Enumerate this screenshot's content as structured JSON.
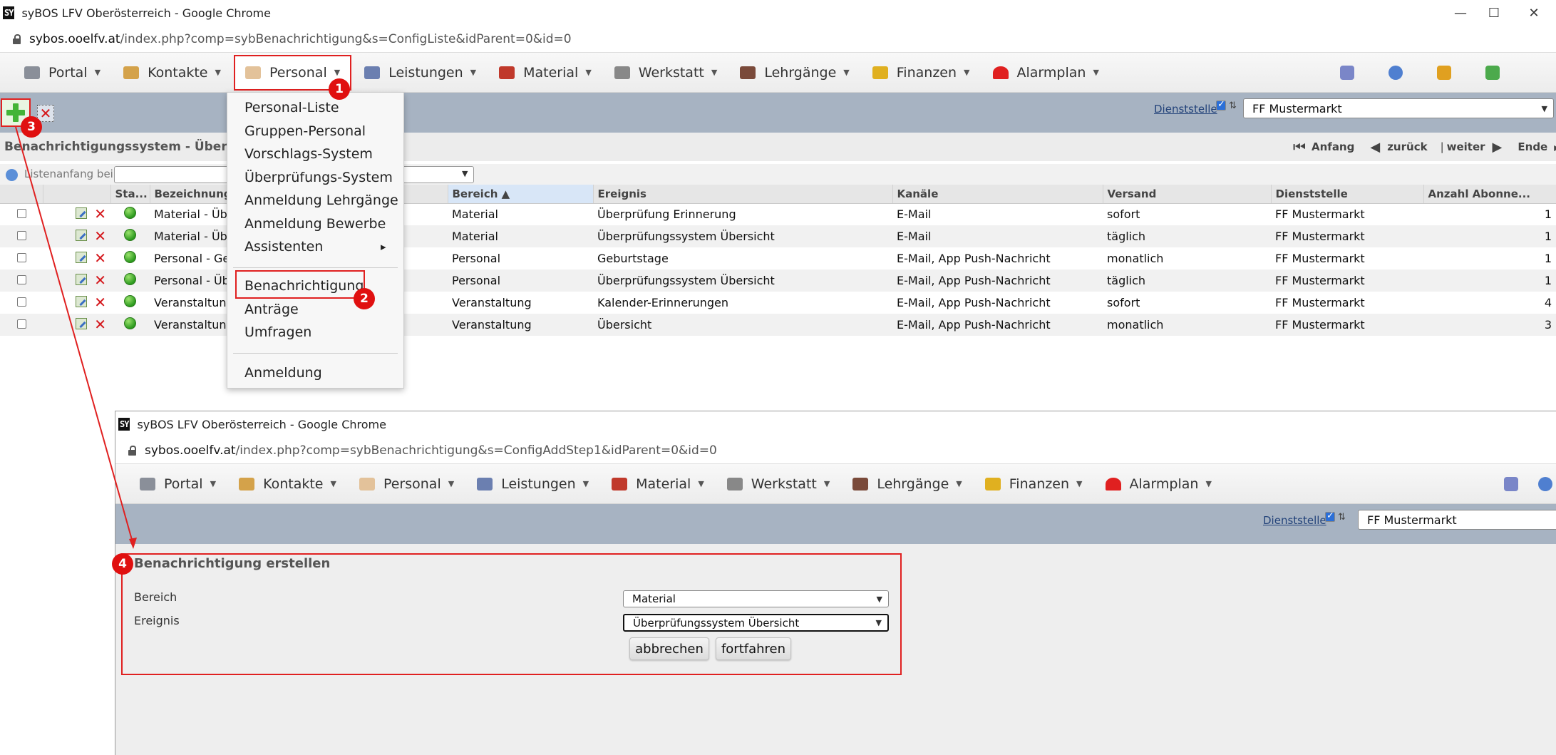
{
  "window": {
    "title": "syBOS LFV Oberösterreich - Google Chrome",
    "logo": "SY",
    "controls": [
      "—",
      "☐",
      "✕"
    ]
  },
  "address": {
    "host": "sybos.ooelfv.at",
    "path": "/index.php?comp=sybBenachrichtigung&s=ConfigListe&idParent=0&id=0"
  },
  "nav": {
    "items": [
      {
        "label": "Portal",
        "icon": "portal-icon",
        "color": "#8a8f99"
      },
      {
        "label": "Kontakte",
        "icon": "contacts-icon",
        "color": "#d4a24a"
      },
      {
        "label": "Personal",
        "icon": "person-icon",
        "color": "#e3c29a"
      },
      {
        "label": "Leistungen",
        "icon": "gears-icon",
        "color": "#6b7fb0"
      },
      {
        "label": "Material",
        "icon": "truck-icon",
        "color": "#c0392b"
      },
      {
        "label": "Werkstatt",
        "icon": "wrench-icon",
        "color": "#888888"
      },
      {
        "label": "Lehrgänge",
        "icon": "instructor-icon",
        "color": "#7a4a3a"
      },
      {
        "label": "Finanzen",
        "icon": "money-icon",
        "color": "#e0b020"
      },
      {
        "label": "Alarmplan",
        "icon": "siren-icon",
        "color": "#e02020"
      }
    ],
    "right_icons": [
      "network-icon",
      "info-icon",
      "phone-icon",
      "logout-icon"
    ]
  },
  "toolbar": {
    "dienststelle_label": "Dienststelle",
    "tree_icon": "⇅",
    "dienststelle_value": "FF Mustermarkt"
  },
  "page": {
    "title": "Benachrichtigungssystem - Übersi",
    "pager": {
      "first": "Anfang",
      "prev": "zurück",
      "sep": "|",
      "next": "weiter",
      "last": "Ende"
    },
    "filter_label": "Listenanfang bei:"
  },
  "table": {
    "headers": [
      "Sta...",
      "Bezeichnung",
      "Bereich ▲",
      "Ereignis",
      "Kanäle",
      "Versand",
      "Dienststelle",
      "Anzahl Abonne..."
    ],
    "rows": [
      {
        "bez": "Material - Übe",
        "bereich": "Material",
        "ereignis": "Überprüfung Erinnerung",
        "kanaele": "E-Mail",
        "versand": "sofort",
        "dienst": "FF Mustermarkt",
        "anzahl": "1"
      },
      {
        "bez": "Material - Übe",
        "bereich": "Material",
        "ereignis": "Überprüfungssystem Übersicht",
        "kanaele": "E-Mail",
        "versand": "täglich",
        "dienst": "FF Mustermarkt",
        "anzahl": "1"
      },
      {
        "bez": "Personal - Ge",
        "bereich": "Personal",
        "ereignis": "Geburtstage",
        "kanaele": "E-Mail, App Push-Nachricht",
        "versand": "monatlich",
        "dienst": "FF Mustermarkt",
        "anzahl": "1"
      },
      {
        "bez": "Personal - Üb",
        "bereich": "Personal",
        "ereignis": "Überprüfungssystem Übersicht",
        "kanaele": "E-Mail, App Push-Nachricht",
        "versand": "täglich",
        "dienst": "FF Mustermarkt",
        "anzahl": "1"
      },
      {
        "bez": "Veranstaltung",
        "bereich": "Veranstaltung",
        "ereignis": "Kalender-Erinnerungen",
        "kanaele": "E-Mail, App Push-Nachricht",
        "versand": "sofort",
        "dienst": "FF Mustermarkt",
        "anzahl": "4"
      },
      {
        "bez": "Veranstaltung",
        "bereich": "Veranstaltung",
        "ereignis": "Übersicht",
        "kanaele": "E-Mail, App Push-Nachricht",
        "versand": "monatlich",
        "dienst": "FF Mustermarkt",
        "anzahl": "3"
      }
    ]
  },
  "menu": {
    "items": [
      "Personal-Liste",
      "Gruppen-Personal",
      "Vorschlags-System",
      "Überprüfungs-System",
      "Anmeldung Lehrgänge",
      "Anmeldung Bewerbe",
      "Assistenten"
    ],
    "submenu_arrow": "▸",
    "items2": [
      "Benachrichtigung",
      "Anträge",
      "Umfragen"
    ],
    "items3": [
      "Anmeldung"
    ]
  },
  "badges": [
    "1",
    "2",
    "3",
    "4"
  ],
  "second_window": {
    "title": "syBOS LFV Oberösterreich - Google Chrome",
    "host": "sybos.ooelfv.at",
    "path": "/index.php?comp=sybBenachrichtigung&s=ConfigAddStep1&idParent=0&id=0",
    "dienststelle_label": "Dienststelle",
    "dienststelle_value": "FF Mustermarkt",
    "form": {
      "title": "Benachrichtigung erstellen",
      "bereich_label": "Bereich",
      "bereich_value": "Material",
      "ereignis_label": "Ereignis",
      "ereignis_value": "Überprüfungssystem Übersicht",
      "cancel": "abbrechen",
      "continue": "fortfahren"
    }
  },
  "colors": {
    "accent_red": "#e02020",
    "graybar": "#a7b3c2",
    "status_green": "#2c9a1e"
  }
}
